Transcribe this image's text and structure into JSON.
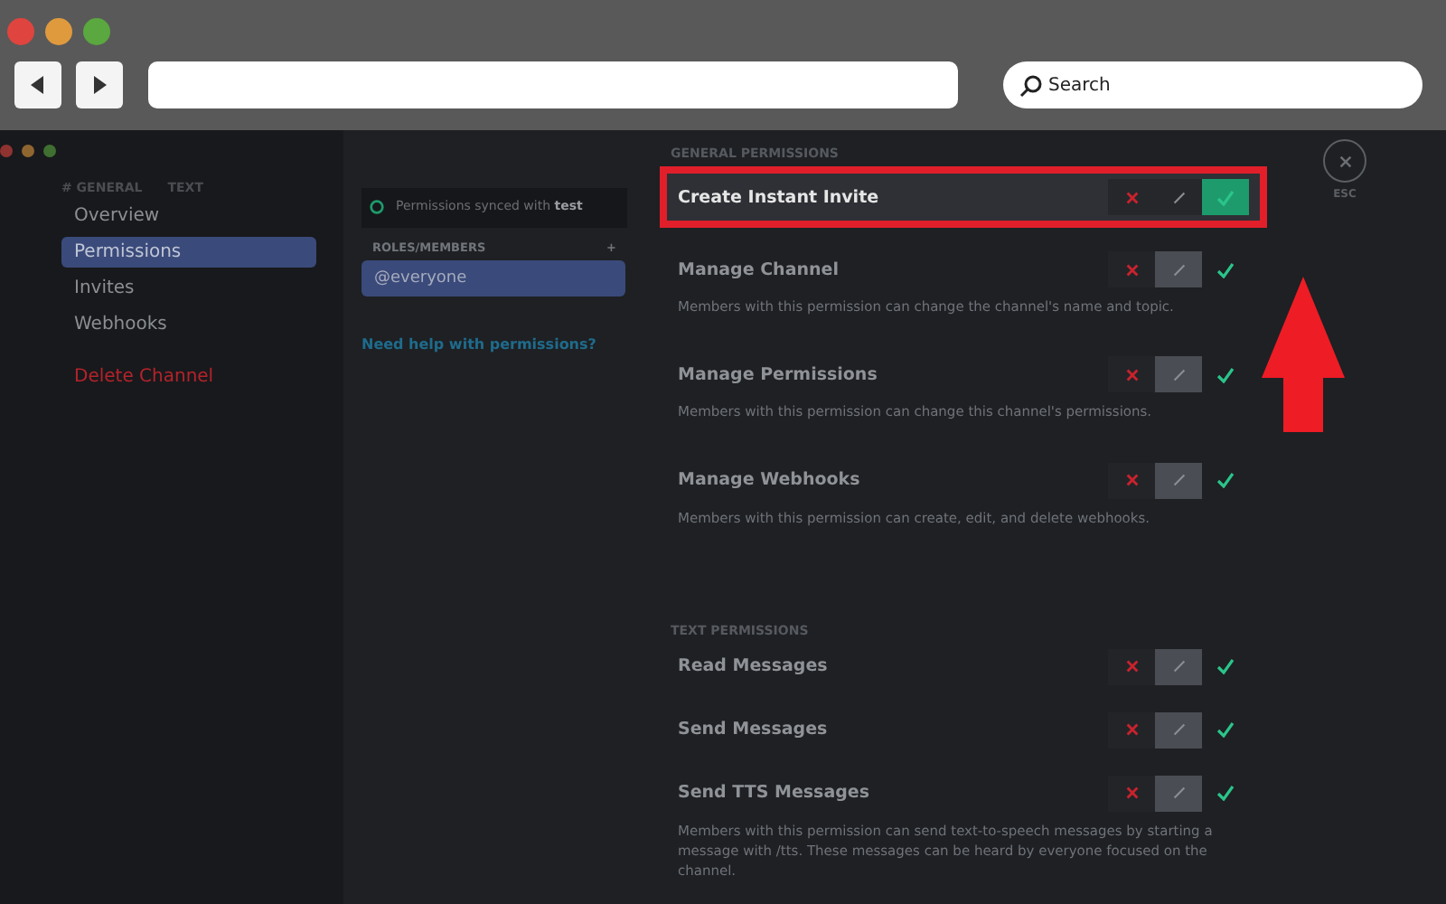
{
  "browser": {
    "search": {
      "placeholder": "Search"
    }
  },
  "sidebar": {
    "header": "# GENERAL",
    "header_tag": "TEXT",
    "items": [
      {
        "label": "Overview",
        "selected": false,
        "kind": "link"
      },
      {
        "label": "Permissions",
        "selected": true,
        "kind": "link"
      },
      {
        "label": "Invites",
        "selected": false,
        "kind": "link"
      },
      {
        "label": "Webhooks",
        "selected": false,
        "kind": "link"
      },
      {
        "label": "Delete Channel",
        "selected": false,
        "kind": "danger"
      }
    ]
  },
  "roles": {
    "sync_notice": "Permissions synced with",
    "sync_target": "test",
    "header": "ROLES/MEMBERS",
    "add": "+",
    "items": [
      {
        "label": "@everyone",
        "selected": true
      }
    ],
    "help_link": "Need help with permissions?"
  },
  "close": {
    "label": "ESC"
  },
  "sections": [
    {
      "title": "GENERAL PERMISSIONS",
      "permissions": [
        {
          "name": "Create Instant Invite",
          "options": [
            {
              "kind": "deny",
              "selected": false
            },
            {
              "kind": "neutral",
              "selected": false
            },
            {
              "kind": "allow",
              "selected": true
            }
          ],
          "highlighted": true
        },
        {
          "name": "Manage Channel",
          "options": [
            {
              "kind": "deny",
              "selected": false
            },
            {
              "kind": "neutral",
              "selected": true
            },
            {
              "kind": "allow",
              "selected": false
            }
          ],
          "highlighted": false,
          "description": "Members with this permission can change the channel's name and topic."
        },
        {
          "name": "Manage Permissions",
          "options": [
            {
              "kind": "deny",
              "selected": false
            },
            {
              "kind": "neutral",
              "selected": true
            },
            {
              "kind": "allow",
              "selected": false
            }
          ],
          "highlighted": false,
          "description": "Members with this permission can change this channel's permissions."
        },
        {
          "name": "Manage Webhooks",
          "options": [
            {
              "kind": "deny",
              "selected": false
            },
            {
              "kind": "neutral",
              "selected": true
            },
            {
              "kind": "allow",
              "selected": false
            }
          ],
          "highlighted": false,
          "description": "Members with this permission can create, edit, and delete webhooks."
        }
      ]
    },
    {
      "title": "TEXT PERMISSIONS",
      "permissions": [
        {
          "name": "Read Messages",
          "options": [
            {
              "kind": "deny",
              "selected": false
            },
            {
              "kind": "neutral",
              "selected": true
            },
            {
              "kind": "allow",
              "selected": false
            }
          ],
          "highlighted": false
        },
        {
          "name": "Send Messages",
          "options": [
            {
              "kind": "deny",
              "selected": false
            },
            {
              "kind": "neutral",
              "selected": true
            },
            {
              "kind": "allow",
              "selected": false
            }
          ],
          "highlighted": false
        },
        {
          "name": "Send TTS Messages",
          "options": [
            {
              "kind": "deny",
              "selected": false
            },
            {
              "kind": "neutral",
              "selected": true
            },
            {
              "kind": "allow",
              "selected": false
            }
          ],
          "highlighted": false,
          "description": "Members with this permission can send text-to-speech messages by starting a message with /tts. These messages can be heard by everyone focused on the channel."
        }
      ]
    }
  ]
}
